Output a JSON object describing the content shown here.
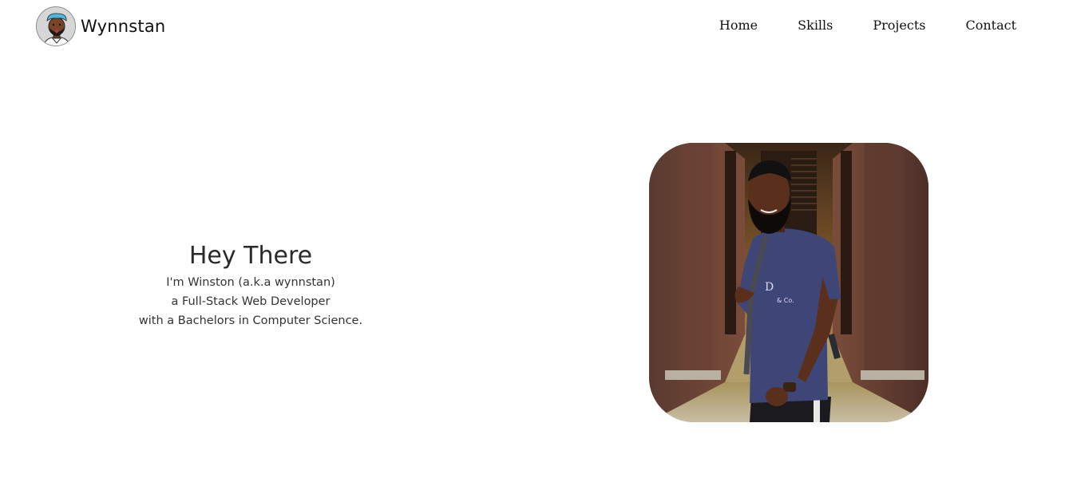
{
  "brand": {
    "name": "Wynnstan",
    "avatar_icon": "cartoon-avatar-icon"
  },
  "nav": {
    "items": [
      {
        "label": "Home"
      },
      {
        "label": "Skills"
      },
      {
        "label": "Projects"
      },
      {
        "label": "Contact"
      }
    ]
  },
  "hero": {
    "title": "Hey There",
    "lines": [
      "I'm Winston (a.k.a wynnstan)",
      "a Full-Stack Web Developer",
      "with a Bachelors in Computer Science."
    ],
    "photo_icon": "profile-photo"
  },
  "colors": {
    "background": "#ffffff",
    "text": "#222222",
    "shirt": "#3d4677",
    "hair": "#4fb7d9"
  }
}
